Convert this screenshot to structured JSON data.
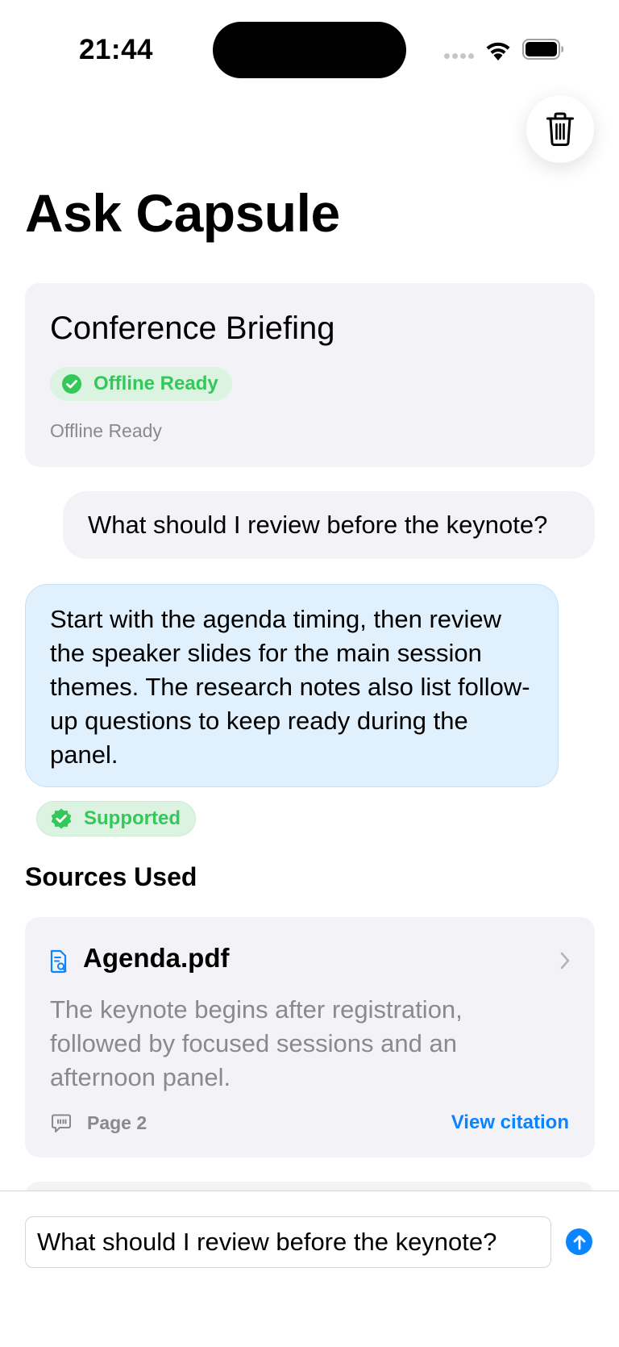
{
  "status_bar": {
    "time": "21:44"
  },
  "header": {
    "title": "Ask Capsule",
    "delete_icon": "trash-icon"
  },
  "capsule": {
    "name": "Conference Briefing",
    "badge_label": "Offline Ready",
    "status_text": "Offline Ready",
    "badge_color": "#34c759"
  },
  "conversation": {
    "question": "What should I review before the keynote?",
    "answer": "Start with the agenda timing, then review the speaker slides for the main session themes. The research notes also list follow-up questions to keep ready during the panel.",
    "support_label": "Supported"
  },
  "sources": {
    "title": "Sources Used",
    "items": [
      {
        "name": "Agenda.pdf",
        "excerpt": "The keynote begins after registration, followed by focused sessions and an afternoon panel.",
        "page": "Page 2",
        "action": "View citation"
      }
    ]
  },
  "composer": {
    "value": "What should I review before the keynote?",
    "send_icon": "arrow-up-circle-icon"
  },
  "colors": {
    "accent": "#0a84ff",
    "success": "#34c759",
    "answer_bg": "#e0f0fd",
    "card_bg": "#f2f2f7"
  }
}
